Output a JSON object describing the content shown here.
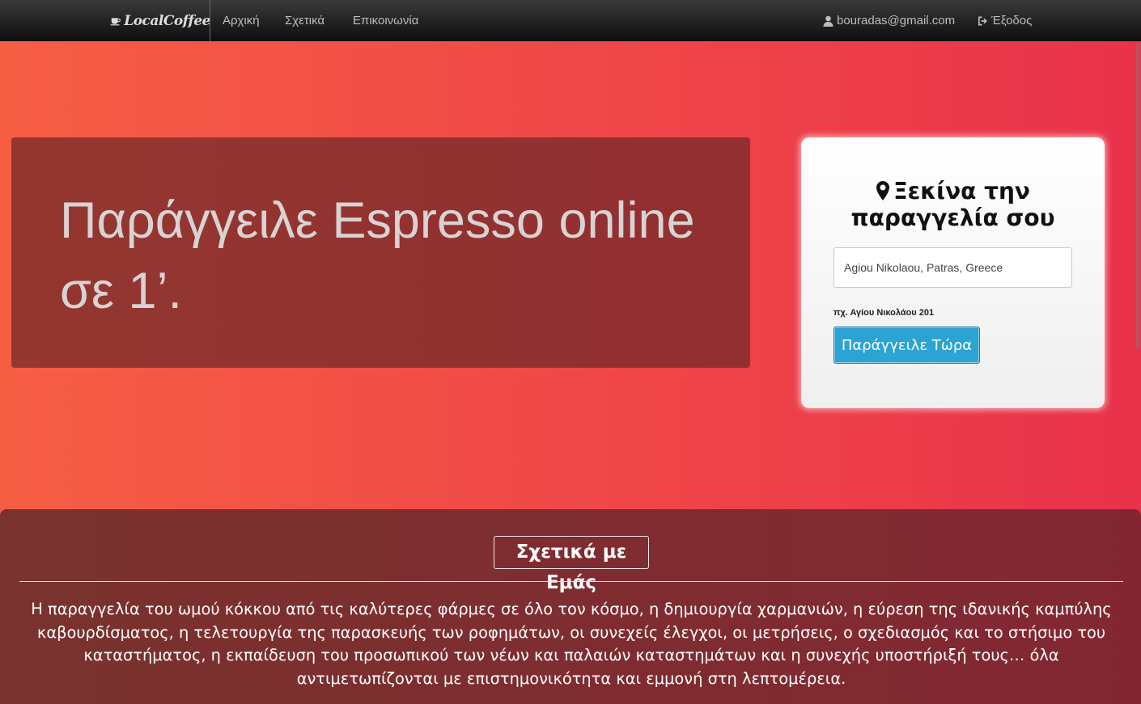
{
  "nav": {
    "brand": "LocalCoffee",
    "links": [
      "Αρχική",
      "Σχετικά",
      "Επικοινωνία"
    ],
    "user_email": "bouradas@gmail.com",
    "logout_label": "Έξοδος"
  },
  "hero": {
    "title": "Παράγγειλε Espresso online σε 1’."
  },
  "order": {
    "title": "Ξεκίνα την παραγγελία σου",
    "address_value": "Agiou Nikolaou, Patras, Greece",
    "hint": "πχ. Αγίου Νικολάου 201",
    "button_label": "Παράγγειλε Τώρα"
  },
  "about": {
    "title": "Σχετικά με Εμάς",
    "text": "Η παραγγελία του ωμού κόκκου από τις καλύτερες φάρμες σε όλο τον κόσμο, η δημιουργία χαρμανιών, η εύρεση της ιδανικής καμπύλης καβουρδίσματος, η τελετουργία της παρασκευής των ροφημάτων, οι συνεχείς έλεγχοι, οι μετρήσεις, ο σχεδιασμός και το στήσιμο του καταστήματος, η εκπαίδευση του προσωπικού των νέων και παλαιών καταστημάτων και η συνεχής υποστήριξή τους… όλα αντιμετωπίζονται με επιστημονικότητα και εμμονή στη λεπτομέρεια."
  },
  "icons": {
    "brand": "coffee-cup-icon",
    "user": "user-icon",
    "logout": "sign-out-icon",
    "pin": "map-marker-icon"
  }
}
